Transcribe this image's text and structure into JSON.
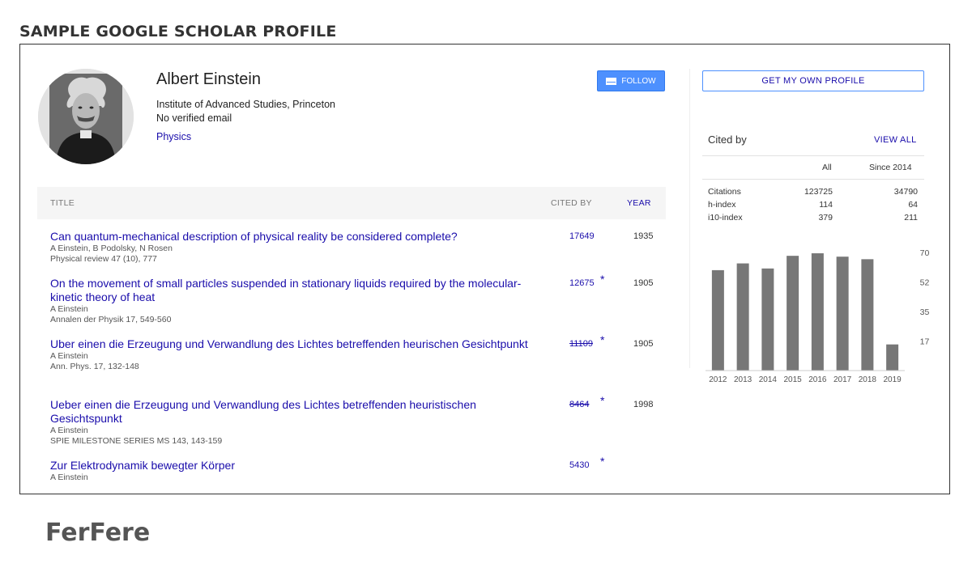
{
  "heading": "SAMPLE GOOGLE SCHOLAR PROFILE",
  "profile": {
    "name": "Albert Einstein",
    "affiliation": "Institute of Advanced Studies, Princeton",
    "email": "No verified email",
    "interest": "Physics",
    "follow_label": "FOLLOW",
    "get_profile_label": "GET MY OWN PROFILE"
  },
  "table": {
    "col_title": "TITLE",
    "col_cited": "CITED BY",
    "col_year": "YEAR",
    "rows": [
      {
        "title": "Can quantum-mechanical description of physical reality be considered complete?",
        "authors": "A Einstein, B Podolsky, N Rosen",
        "venue": "Physical review 47 (10), 777",
        "cited": "17649",
        "star": "",
        "year": "1935",
        "strike": false
      },
      {
        "title": "On the movement of small particles suspended in stationary liquids required by the molecular-kinetic theory of heat",
        "authors": "A Einstein",
        "venue": "Annalen der Physik 17, 549-560",
        "cited": "12675",
        "star": "*",
        "year": "1905",
        "strike": false
      },
      {
        "title": "Uber einen die Erzeugung und Verwandlung des Lichtes betreffenden heurischen Gesichtpunkt",
        "authors": "A Einstein",
        "venue": "Ann. Phys. 17, 132-148",
        "cited": "11109",
        "star": "*",
        "year": "1905",
        "strike": true
      },
      {
        "title": "Ueber einen die Erzeugung und Verwandlung des Lichtes betreffenden heuristischen Gesichtspunkt",
        "authors": "A Einstein",
        "venue": "SPIE MILESTONE SERIES MS 143, 143-159",
        "cited": "8464",
        "star": "*",
        "year": "1998",
        "strike": true
      },
      {
        "title": "Zur Elektrodynamik bewegter Körper",
        "authors": "A Einstein",
        "venue": "",
        "cited": "5430",
        "star": "*",
        "year": "",
        "strike": false
      }
    ]
  },
  "cited_by": {
    "title": "Cited by",
    "view_all": "VIEW ALL",
    "col_all": "All",
    "col_since": "Since 2014",
    "metrics": [
      {
        "label": "Citations",
        "all": "123725",
        "since": "34790"
      },
      {
        "label": "h-index",
        "all": "114",
        "since": "64"
      },
      {
        "label": "i10-index",
        "all": "379",
        "since": "211"
      }
    ]
  },
  "chart_data": {
    "type": "bar",
    "categories": [
      "2012",
      "2013",
      "2014",
      "2015",
      "2016",
      "2017",
      "2018",
      "2019"
    ],
    "values": [
      5950,
      6350,
      6050,
      6800,
      6950,
      6750,
      6600,
      1550
    ],
    "ylim": [
      0,
      7000
    ],
    "yticks": [
      "7000",
      "5250",
      "3500",
      "1750",
      "0"
    ],
    "bar_color": "#777777"
  },
  "colors": {
    "link": "#1a0dab",
    "button_blue": "#4d90fe"
  },
  "watermark": "FerFere"
}
